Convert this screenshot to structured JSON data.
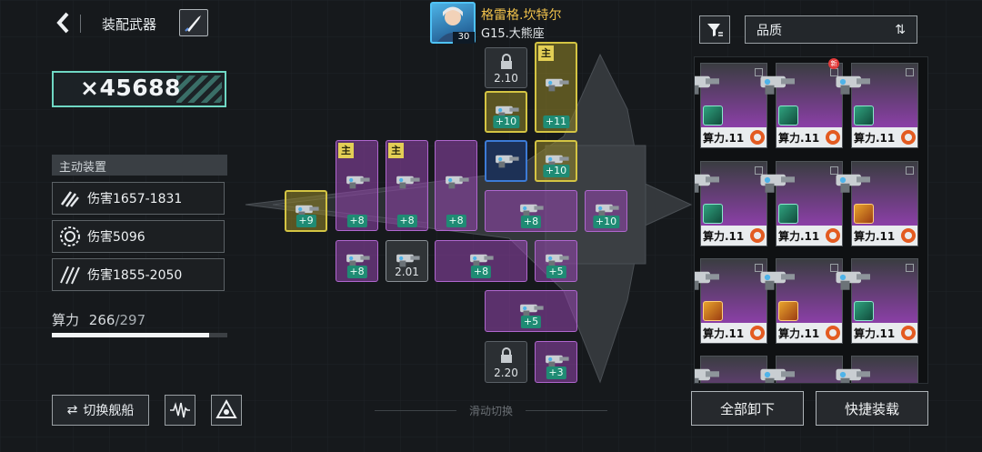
{
  "header": {
    "title": "装配武器"
  },
  "power": {
    "value": "×45688"
  },
  "active": {
    "label": "主动装置",
    "stats": [
      {
        "icon": "claw-slash-icon",
        "text": "伤害1657-1831"
      },
      {
        "icon": "target-ring-icon",
        "text": "伤害5096"
      },
      {
        "icon": "triple-slash-icon",
        "text": "伤害1855-2050"
      }
    ]
  },
  "compute": {
    "label": "算力",
    "current": "266",
    "max": "/297",
    "fraction": 0.8956
  },
  "buttons": {
    "switch_ship": "切换舰船",
    "unload_all": "全部卸下",
    "quick_equip": "快捷装载"
  },
  "swipe_hint": "滑动切换",
  "captain": {
    "name": "格雷格.坎特尔",
    "level": "30",
    "ship": "G15.大熊座"
  },
  "sort": {
    "label": "品质"
  },
  "slot_main_tag": "主",
  "slots": [
    {
      "kind": "locked",
      "value": "2.10"
    },
    {
      "kind": "gold",
      "main": true,
      "level": "+11",
      "item": "blade-weapon-icon"
    },
    {
      "kind": "gold",
      "level": "+10",
      "item": "launcher-weapon-icon"
    },
    {
      "kind": "blue",
      "item": "canister-weapon-icon"
    },
    {
      "kind": "gold",
      "level": "+10",
      "item": "plasma-gun-icon"
    },
    {
      "kind": "purple",
      "main": true,
      "level": "+8",
      "item": "turret-weapon-icon"
    },
    {
      "kind": "purple",
      "main": true,
      "level": "+8",
      "item": "missile-pod-icon"
    },
    {
      "kind": "purple",
      "level": "+8",
      "item": "cannon-weapon-icon"
    },
    {
      "kind": "gold",
      "level": "+9",
      "item": "mortar-weapon-icon"
    },
    {
      "kind": "purple",
      "level": "+8",
      "item": "twin-cannon-icon"
    },
    {
      "kind": "purple",
      "level": "+10",
      "item": "heavy-gun-icon"
    },
    {
      "kind": "purple",
      "level": "+8",
      "item": "turret-weapon-icon"
    },
    {
      "kind": "grey",
      "value": "2.01",
      "item": "core-module-icon"
    },
    {
      "kind": "purple",
      "level": "+8",
      "item": "gatling-weapon-icon"
    },
    {
      "kind": "purple",
      "level": "+5",
      "item": "rail-gun-icon"
    },
    {
      "kind": "purple",
      "level": "+5",
      "item": "rocket-rack-icon"
    },
    {
      "kind": "locked",
      "value": "2.20"
    },
    {
      "kind": "purple",
      "level": "+3",
      "item": "beam-gun-icon"
    }
  ],
  "inventory": [
    {
      "label": "算力.11",
      "badge": "green",
      "new": false
    },
    {
      "label": "算力.11",
      "badge": "green",
      "new": true
    },
    {
      "label": "算力.11",
      "badge": "green",
      "new": false
    },
    {
      "label": "算力.11",
      "badge": "green",
      "new": false
    },
    {
      "label": "算力.11",
      "badge": "green",
      "new": false
    },
    {
      "label": "算力.11",
      "badge": "orange",
      "new": false
    },
    {
      "label": "算力.11",
      "badge": "orange",
      "new": false
    },
    {
      "label": "算力.11",
      "badge": "orange",
      "new": false
    },
    {
      "label": "算力.11",
      "badge": "green",
      "new": false
    }
  ],
  "colors": {
    "accent": "#6fd8c4",
    "gold": "#d4c443",
    "purple": "#b067cf",
    "level_badge": "#1f8b74"
  }
}
